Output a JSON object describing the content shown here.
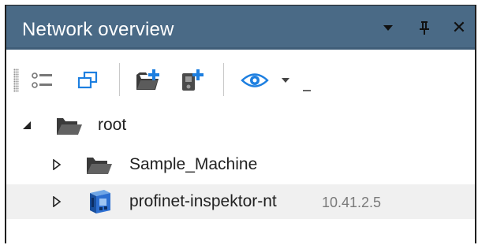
{
  "panel": {
    "title": "Network overview",
    "title_bar_color": "#4a6a86",
    "controls": [
      {
        "name": "dropdown-arrow-icon"
      },
      {
        "name": "pin-icon"
      },
      {
        "name": "close-icon",
        "glyph": "✕"
      }
    ]
  },
  "toolbar": {
    "tools": [
      {
        "name": "list-view-icon"
      },
      {
        "name": "window-clone-icon"
      },
      {
        "name": "add-folder-icon"
      },
      {
        "name": "add-device-icon"
      },
      {
        "name": "eye-view-icon"
      }
    ],
    "accent_color": "#1d7fe0"
  },
  "tree": {
    "nodes": [
      {
        "label": "root",
        "icon": "folder-open-icon",
        "expanded": true,
        "level": 0
      },
      {
        "label": "Sample_Machine",
        "icon": "folder-open-icon",
        "expanded": false,
        "level": 1
      },
      {
        "label": "profinet-inspektor-nt",
        "extra": "10.41.2.5",
        "icon": "network-device-icon",
        "expanded": false,
        "level": 1,
        "selected": true
      }
    ]
  }
}
